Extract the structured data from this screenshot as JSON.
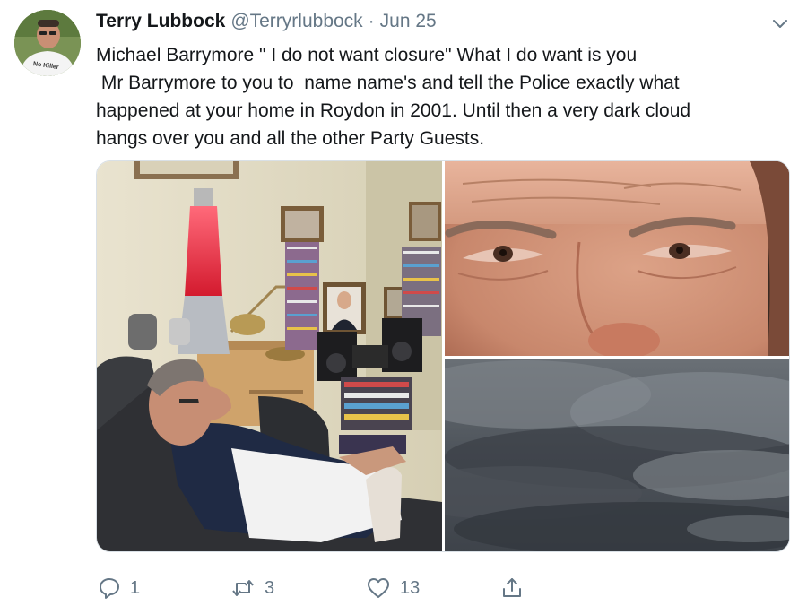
{
  "tweet": {
    "display_name": "Terry Lubbock",
    "handle": "@Terryrlubbock",
    "separator": "·",
    "date": "Jun 25",
    "text_lines": [
      "Michael Barrymore \" I do not want closure\" What I do want is you",
      " Mr Barrymore to you to  name name's and tell the Police exactly what",
      "happened at your home in Roydon in 2001. Until then a very dark cloud",
      "hangs over you and all the other Party Guests."
    ],
    "avatar_shirt_text": "No Killer"
  },
  "icons": {
    "menu": "chevron-down-icon",
    "reply": "reply-icon",
    "retweet": "retweet-icon",
    "like": "heart-icon",
    "share": "share-icon"
  },
  "actions": {
    "replies": "1",
    "retweets": "3",
    "likes": "13"
  },
  "colors": {
    "text": "#14171a",
    "secondary": "#657786",
    "border": "#d9e0e6"
  }
}
